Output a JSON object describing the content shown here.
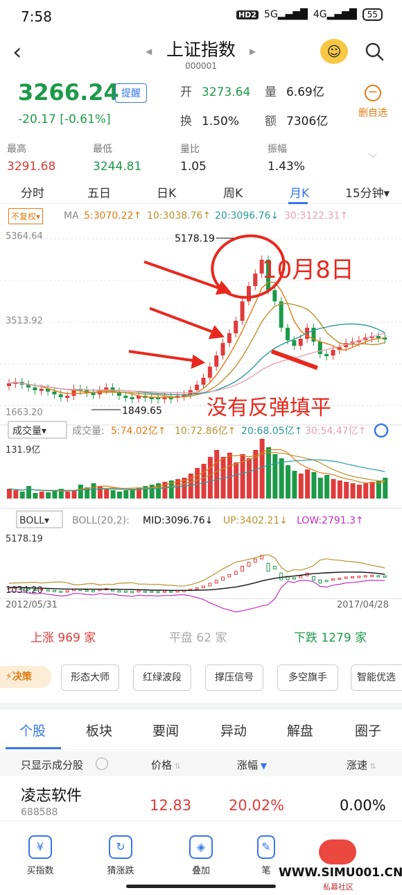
{
  "status": {
    "time": "7:58",
    "hd": "HD2",
    "net1": "5G",
    "net2": "4G",
    "battery": "55"
  },
  "nav": {
    "title": "上证指数",
    "code": "000001"
  },
  "quote": {
    "price": "3266.24",
    "remind": "提醒",
    "change": "-20.17",
    "change_pct": "[-0.61%]",
    "open_label": "开",
    "open": "3273.64",
    "vol_label": "量",
    "vol": "6.69亿",
    "turnover_label": "换",
    "turnover": "1.50%",
    "amount_label": "额",
    "amount": "7306亿",
    "delete_fav": "删自选"
  },
  "stats": [
    {
      "label": "最高",
      "value": "3291.68"
    },
    {
      "label": "最低",
      "value": "3244.81"
    },
    {
      "label": "量比",
      "value": "1.05"
    },
    {
      "label": "振幅",
      "value": "1.43%"
    }
  ],
  "tabs": [
    "分时",
    "五日",
    "日K",
    "周K",
    "月K",
    "15分钟▾"
  ],
  "ma": {
    "chip": "不复权▾",
    "label": "MA",
    "ma5": "5:3070.22↑",
    "ma10": "10:3038.76↑",
    "ma20": "20:3096.76↓",
    "ma30": "30:3122.31↑"
  },
  "main_chart": {
    "y_top": "5364.64",
    "y_mid": "3513.92",
    "y_bot": "1663.20",
    "high_label": "5178.19",
    "low_label": "1849.65"
  },
  "annotations": {
    "date_note": "10月8日",
    "no_fill_note": "没有反弹填平"
  },
  "volume": {
    "chip": "成交量▾",
    "label": "成交量:",
    "v5": "5:74.02亿↑",
    "v10": "10:72.86亿↑",
    "v20": "20:68.05亿↑",
    "v30": "30:54.47亿↑",
    "y_top": "131.9亿"
  },
  "boll": {
    "chip": "BOLL▾",
    "label": "BOLL(20,2):",
    "mid": "MID:3096.76↓",
    "up": "UP:3402.21↓",
    "low": "LOW:2791.3↑",
    "y_top": "5178.19",
    "y_bot": "1034.20"
  },
  "dates": {
    "start": "2012/05/31",
    "end": "2017/04/28"
  },
  "market": {
    "up_label": "上涨",
    "up": "969",
    "up_unit": "家",
    "flat_label": "平盘",
    "flat": "62",
    "flat_unit": "家",
    "down_label": "下跌",
    "down": "1279",
    "down_unit": "家"
  },
  "decide": {
    "label": "决策",
    "buttons": [
      "形态大师",
      "红绿波段",
      "撑压信号",
      "多空旗手",
      "智能优选"
    ]
  },
  "stock_tabs": [
    "个股",
    "板块",
    "要闻",
    "异动",
    "解盘",
    "圈子"
  ],
  "table": {
    "filter": "只显示成分股",
    "price": "价格",
    "change": "涨幅",
    "speed": "涨速"
  },
  "row": {
    "name": "凌志软件",
    "code": "688588",
    "price": "12.83",
    "change": "20.02%",
    "speed": "0.00%"
  },
  "bottom": [
    "买指数",
    "猜涨跌",
    "叠加",
    "笔"
  ],
  "watermark": {
    "site": "WWW.SIMU001.CN",
    "sub": "私募社区"
  },
  "colors": {
    "up": "#e03b3b",
    "down": "#1c9a48",
    "accent": "#3776e8",
    "orange": "#e07b12"
  }
}
